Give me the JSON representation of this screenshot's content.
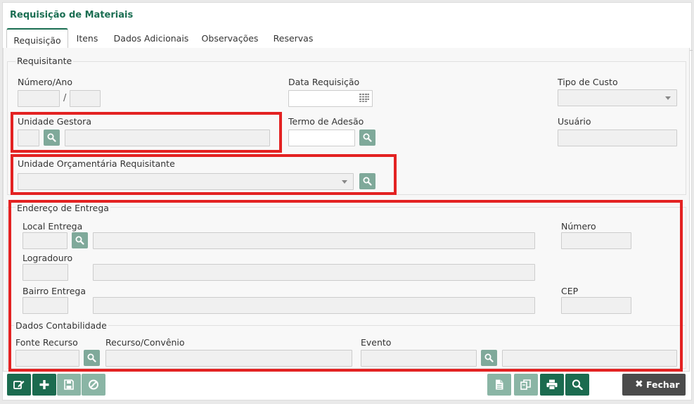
{
  "window": {
    "title": "Requisição de Materiais"
  },
  "tabs": [
    {
      "label": "Requisição",
      "active": true
    },
    {
      "label": "Itens"
    },
    {
      "label": "Dados Adicionais"
    },
    {
      "label": "Observações"
    },
    {
      "label": "Reservas"
    }
  ],
  "requisitante": {
    "legend": "Requisitante",
    "numero_ano_label": "Número/Ano",
    "numero_value": "",
    "ano_value": "",
    "separator": "/",
    "data_requisicao_label": "Data Requisição",
    "data_requisicao_value": "",
    "tipo_custo_label": "Tipo de Custo",
    "tipo_custo_value": "",
    "unidade_gestora_label": "Unidade Gestora",
    "unidade_gestora_code": "",
    "unidade_gestora_name": "",
    "termo_adesao_label": "Termo de Adesão",
    "termo_adesao_value": "",
    "usuario_label": "Usuário",
    "usuario_value": "",
    "unidade_orcamentaria_label": "Unidade Orçamentária Requisitante",
    "unidade_orcamentaria_value": ""
  },
  "endereco": {
    "legend": "Endereço de Entrega",
    "local_entrega_label": "Local Entrega",
    "numero_label": "Número",
    "logradouro_label": "Logradouro",
    "bairro_label": "Bairro Entrega",
    "cep_label": "CEP"
  },
  "contabilidade": {
    "legend": "Dados Contabilidade",
    "fonte_recurso_label": "Fonte Recurso",
    "recurso_convenio_label": "Recurso/Convênio",
    "evento_label": "Evento"
  },
  "toolbar": {
    "fechar_label": "Fechar",
    "icons": [
      "edit-icon",
      "plus-icon",
      "save-icon",
      "cancel-icon",
      "document-icon",
      "copy-icon",
      "print-icon",
      "search-icon",
      "close-icon"
    ]
  },
  "colors": {
    "accent": "#1b6b4f",
    "accent_light": "#8ab5a5",
    "search_button": "#7fa99a",
    "highlight_box": "#e32222",
    "close_button": "#4b4b4b"
  }
}
